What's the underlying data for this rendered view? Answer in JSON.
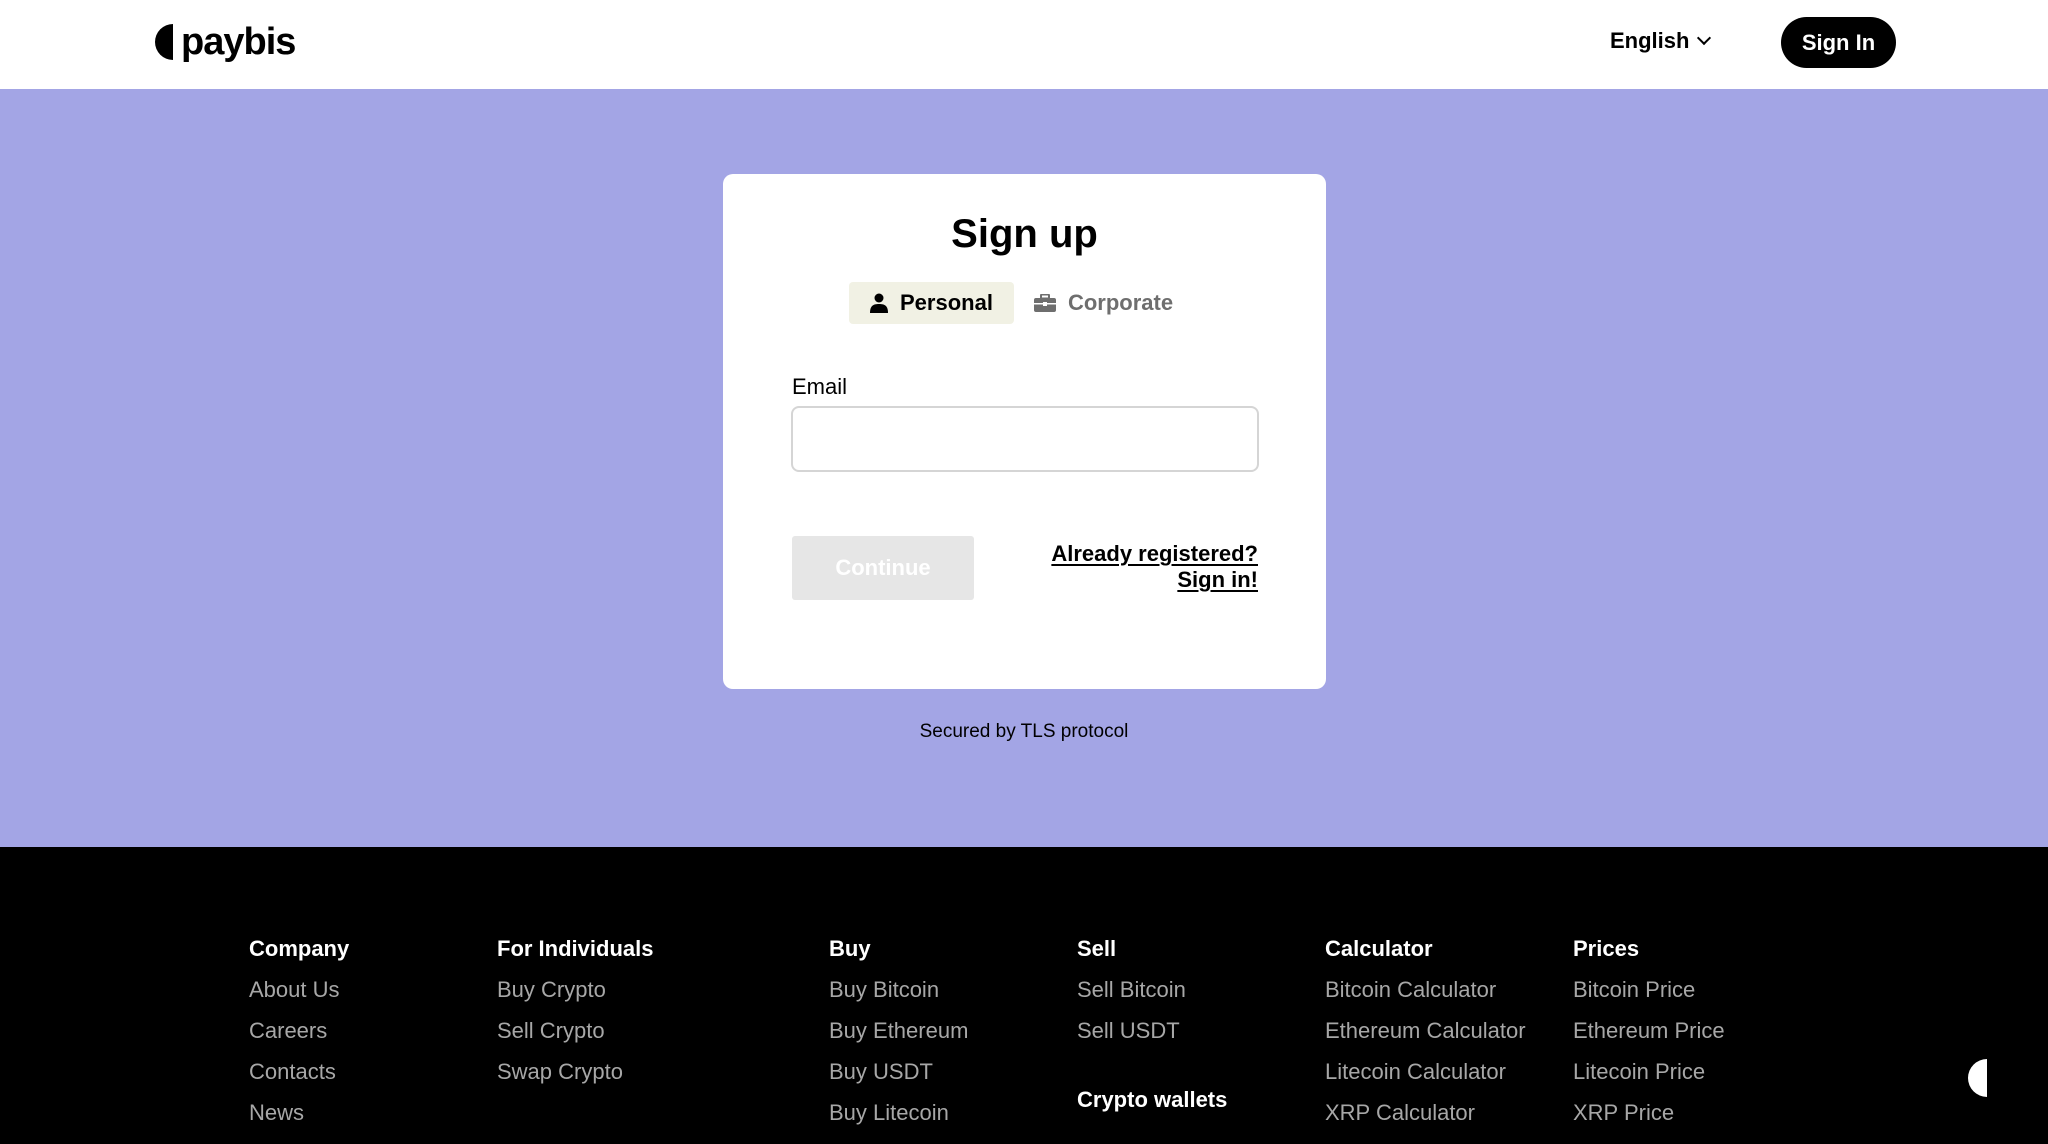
{
  "header": {
    "logo_text": "paybis",
    "language": "English",
    "signin_label": "Sign In"
  },
  "signup": {
    "title": "Sign up",
    "tabs": [
      {
        "label": "Personal",
        "icon": "person-icon",
        "active": true
      },
      {
        "label": "Corporate",
        "icon": "briefcase-icon",
        "active": false
      }
    ],
    "email_label": "Email",
    "email_value": "",
    "continue_label": "Continue",
    "already_line1": "Already registered?",
    "already_line2": "Sign in!"
  },
  "secured_text": "Secured by TLS protocol",
  "footer": {
    "columns": [
      {
        "title": "Company",
        "links": [
          "About Us",
          "Careers",
          "Contacts",
          "News"
        ]
      },
      {
        "title": "For Individuals",
        "links": [
          "Buy Crypto",
          "Sell Crypto",
          "Swap Crypto"
        ]
      },
      {
        "title": "Buy",
        "links": [
          "Buy Bitcoin",
          "Buy Ethereum",
          "Buy USDT",
          "Buy Litecoin"
        ]
      },
      {
        "title": "Sell",
        "links": [
          "Sell Bitcoin",
          "Sell USDT"
        ],
        "subtitle": "Crypto wallets"
      },
      {
        "title": "Calculator",
        "links": [
          "Bitcoin Calculator",
          "Ethereum Calculator",
          "Litecoin Calculator",
          "XRP Calculator"
        ]
      },
      {
        "title": "Prices",
        "links": [
          "Bitcoin Price",
          "Ethereum Price",
          "Litecoin Price",
          "XRP Price"
        ]
      }
    ]
  },
  "colors": {
    "hero_bg": "#a3a5e5",
    "footer_bg": "#000000",
    "active_tab_bg": "#f1f1e4",
    "disabled_button_bg": "#e6e6e6"
  }
}
